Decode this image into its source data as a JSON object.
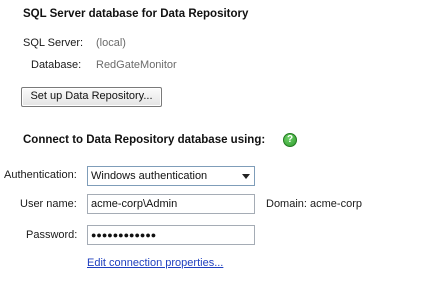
{
  "sql_section": {
    "heading": "SQL Server database for Data Repository",
    "server_label": "SQL Server:",
    "server_value": "(local)",
    "database_label": "Database:",
    "database_value": "RedGateMonitor",
    "setup_button": "Set up Data Repository..."
  },
  "connect_section": {
    "heading": "Connect to Data Repository database using:",
    "help_icon": "help-icon",
    "help_icon_color": "#3fae3c",
    "authentication_label": "Authentication:",
    "authentication_value": "Windows authentication",
    "username_label": "User name:",
    "username_value": "acme-corp\\Admin",
    "domain_text": "Domain: acme-corp",
    "password_label": "Password:",
    "password_value": "●●●●●●●●●●●●",
    "edit_link": "Edit connection properties..."
  }
}
